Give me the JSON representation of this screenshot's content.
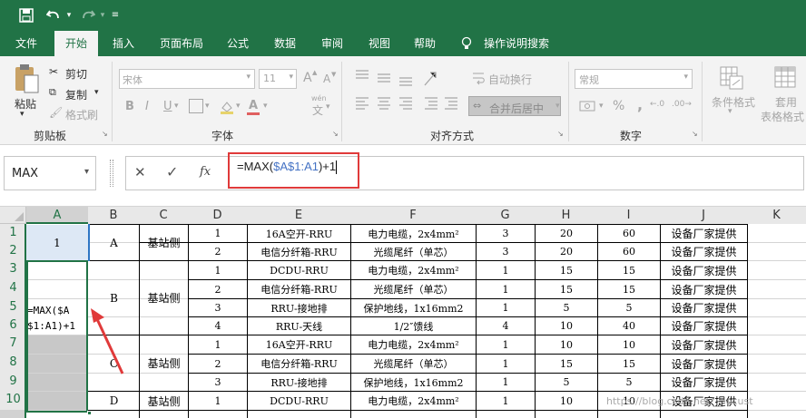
{
  "qat": {
    "save_icon": "save-icon",
    "undo_icon": "undo-icon",
    "redo_icon": "redo-icon",
    "customize_icon": "customize-icon"
  },
  "tabs": [
    {
      "label": "文件"
    },
    {
      "label": "开始"
    },
    {
      "label": "插入"
    },
    {
      "label": "页面布局"
    },
    {
      "label": "公式"
    },
    {
      "label": "数据"
    },
    {
      "label": "审阅"
    },
    {
      "label": "视图"
    },
    {
      "label": "帮助"
    }
  ],
  "tell_me": "操作说明搜索",
  "ribbon": {
    "paste": "粘贴",
    "cut": "剪切",
    "copy": "复制",
    "format_painter": "格式刷",
    "clipboard": "剪贴板",
    "font_name": "宋体",
    "font_size": "11",
    "font_group": "字体",
    "bold": "B",
    "italic": "I",
    "underline": "U",
    "wen": "wén",
    "wen_char": "文",
    "grow": "A",
    "shrink": "A",
    "wrap": "自动换行",
    "merge": "合并后居中",
    "align_group": "对齐方式",
    "number_format": "常规",
    "percent": "%",
    "comma": ",",
    "number_group": "数字",
    "cond_format": "条件格式",
    "table_format": "套用",
    "table_format2": "表格格式"
  },
  "formula_bar": {
    "name_box": "MAX",
    "cancel": "✕",
    "enter": "✓",
    "fx": "fx",
    "formula_prefix": "=MAX(",
    "formula_ref": "$A$1:A1",
    "formula_suffix": ")+1"
  },
  "columns": [
    "A",
    "B",
    "C",
    "D",
    "E",
    "F",
    "G",
    "H",
    "I",
    "J",
    "K"
  ],
  "rows": [
    "1",
    "2",
    "3",
    "4",
    "5",
    "6",
    "7",
    "8",
    "9",
    "10"
  ],
  "cells": {
    "a1": "1",
    "a_formula1": "=MAX($A",
    "a_formula2": "$1:A1)+1",
    "b1": "A",
    "b2": "B",
    "b3": "C",
    "b4": "D",
    "c1": "基站侧",
    "c2": "基站侧",
    "c3": "基站侧",
    "c4": "基站侧",
    "d": [
      "1",
      "2",
      "1",
      "2",
      "3",
      "4",
      "1",
      "2",
      "3",
      "1"
    ],
    "e": [
      "16A空开-RRU",
      "电信分纤箱-RRU",
      "DCDU-RRU",
      "电信分纤箱-RRU",
      "RRU-接地排",
      "RRU-天线",
      "16A空开-RRU",
      "电信分纤箱-RRU",
      "RRU-接地排",
      "DCDU-RRU"
    ],
    "f": [
      "电力电缆，2x4mm²",
      "光缆尾纤（单芯）",
      "电力电缆，2x4mm²",
      "光缆尾纤（单芯）",
      "保护地线，1x16mm2",
      "1/2″馈线",
      "电力电缆，2x4mm²",
      "光缆尾纤（单芯）",
      "保护地线，1x16mm2",
      "电力电缆，2x4mm²"
    ],
    "g": [
      "3",
      "3",
      "1",
      "1",
      "1",
      "4",
      "1",
      "1",
      "1",
      "1"
    ],
    "h": [
      "20",
      "20",
      "15",
      "15",
      "5",
      "10",
      "10",
      "15",
      "5",
      "10"
    ],
    "i": [
      "60",
      "60",
      "15",
      "15",
      "5",
      "40",
      "10",
      "15",
      "5",
      "10"
    ],
    "j": [
      "设备厂家提供",
      "设备厂家提供",
      "设备厂家提供",
      "设备厂家提供",
      "设备厂家提供",
      "设备厂家提供",
      "设备厂家提供",
      "设备厂家提供",
      "设备厂家提供",
      "设备厂家提供"
    ]
  },
  "watermark": "https://blog.csdn.net/__locust",
  "colors": {
    "accent": "#217346",
    "annotation": "#e03a3a",
    "ref": "#4472c4"
  }
}
